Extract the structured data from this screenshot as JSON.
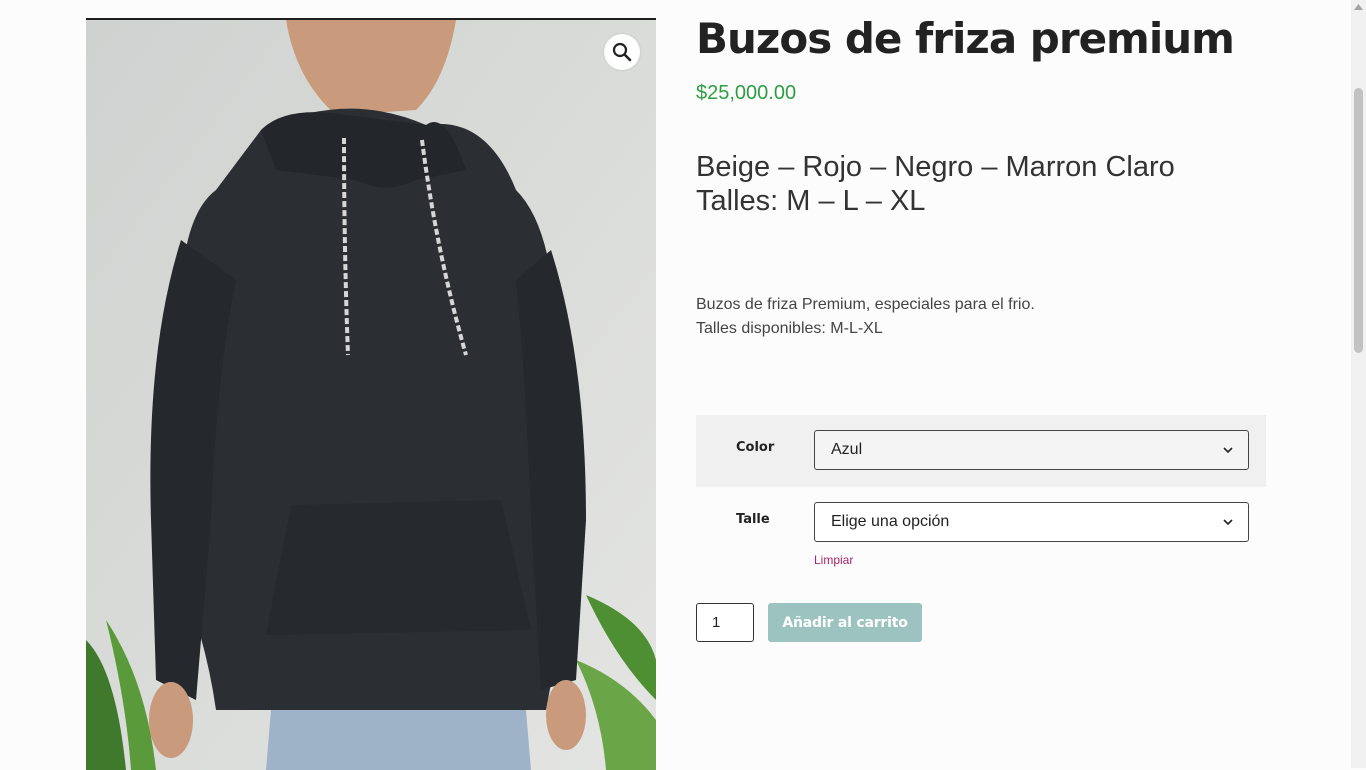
{
  "product": {
    "image_alt": "Buzo de friza negro con capucha",
    "title": "Buzos de friza premium",
    "price": "$25,000.00",
    "short_description": [
      "Beige – Rojo – Negro – Marron Claro",
      "Talles: M – L – XL"
    ],
    "description": [
      "Buzos de friza Premium, especiales para el frio.",
      "Talles disponibles: M-L-XL"
    ]
  },
  "zoom": {
    "icon": "magnifier-icon",
    "glyph": "🔍"
  },
  "variations": {
    "color": {
      "label": "Color",
      "selected": "Azul"
    },
    "talle": {
      "label": "Talle",
      "selected": "Elige una opción"
    },
    "reset_label": "Limpiar"
  },
  "cart": {
    "quantity": "1",
    "add_label": "Añadir al carrito"
  },
  "colors": {
    "price": "#2e9e42",
    "button": "#9dc3c0",
    "reset_link": "#a4286a"
  }
}
